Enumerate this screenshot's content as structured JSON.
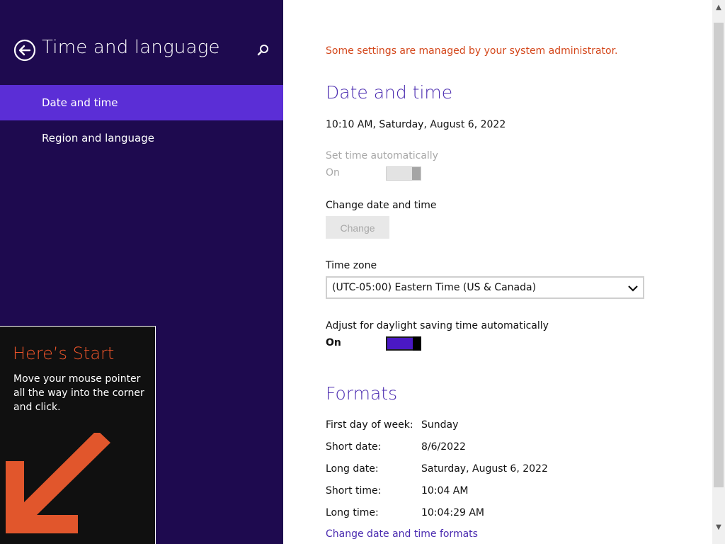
{
  "sidebar": {
    "title": "Time and language",
    "items": [
      {
        "label": "Date and time",
        "selected": true
      },
      {
        "label": "Region and language",
        "selected": false
      }
    ]
  },
  "start_tip": {
    "title": "Here’s Start",
    "body": "Move your mouse pointer all the way into the corner and click."
  },
  "main": {
    "admin_note": "Some settings are managed by your system administrator.",
    "date_time": {
      "heading": "Date and time",
      "current": "10:10 AM, Saturday, August 6, 2022",
      "set_auto_label": "Set time automatically",
      "set_auto_state": "On",
      "change_label": "Change date and time",
      "change_button": "Change",
      "time_zone_label": "Time zone",
      "time_zone_value": "(UTC-05:00) Eastern Time (US & Canada)",
      "dst_label": "Adjust for daylight saving time automatically",
      "dst_state": "On"
    },
    "formats": {
      "heading": "Formats",
      "rows": [
        {
          "label": "First day of week:",
          "value": "Sunday"
        },
        {
          "label": "Short date:",
          "value": "8/6/2022"
        },
        {
          "label": "Long date:",
          "value": "Saturday, August 6, 2022"
        },
        {
          "label": "Short time:",
          "value": "10:04 AM"
        },
        {
          "label": "Long time:",
          "value": "10:04:29 AM"
        }
      ],
      "change_link": "Change date and time formats"
    }
  },
  "colors": {
    "sidebar_bg": "#1e0a4f",
    "selected_item": "#5b2ed6",
    "accent": "#4a2bb0",
    "warning": "#d4471b",
    "tip_title": "#f0552a"
  },
  "icons": [
    "back-arrow-icon",
    "search-icon",
    "chevron-down-icon",
    "start-corner-arrow-icon",
    "scroll-up-arrow-icon",
    "scroll-down-arrow-icon"
  ]
}
